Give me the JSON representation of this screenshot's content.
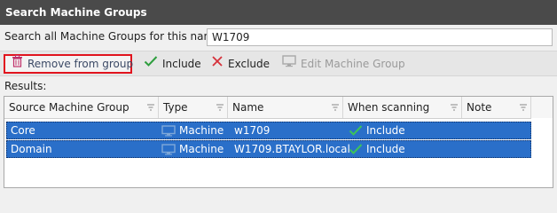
{
  "window": {
    "title": "Search Machine Groups"
  },
  "search": {
    "label": "Search all Machine Groups for this name:",
    "value": "W1709"
  },
  "toolbar": {
    "remove_label": "Remove from group",
    "include_label": "Include",
    "exclude_label": "Exclude",
    "edit_group_label": "Edit Machine Group"
  },
  "results": {
    "label": "Results:",
    "columns": [
      "Source Machine Group",
      "Type",
      "Name",
      "When scanning",
      "Note"
    ],
    "rows": [
      {
        "source": "Core",
        "type": "Machine",
        "name": "w1709",
        "when_scanning": "Include",
        "note": ""
      },
      {
        "source": "Domain",
        "type": "Machine",
        "name": "W1709.BTAYLOR.local",
        "when_scanning": "Include",
        "note": ""
      }
    ]
  },
  "colors": {
    "title_bar": "#4a4a4a",
    "selection": "#2a6fc9",
    "highlight_border": "#e1141e",
    "include_check": "#2e9e3e",
    "exclude_x": "#d6303a"
  },
  "icons": {
    "remove": "trash-icon",
    "include": "check-icon",
    "exclude": "x-icon",
    "edit_group": "monitor-icon",
    "machine": "monitor-icon",
    "filter": "filter-icon"
  }
}
